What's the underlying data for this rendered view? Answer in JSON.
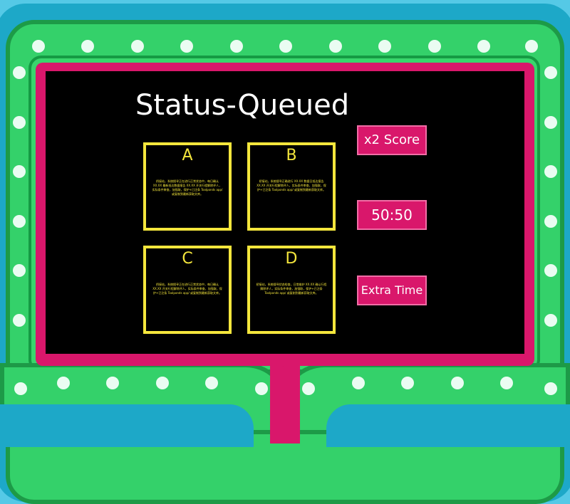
{
  "question": {
    "title": "Status-Queued"
  },
  "answers": [
    {
      "letter": "A",
      "text": "桥接站，系统搜寻正在进行正常状态中，每日确认 XX.XX 最新抵达数据报告 XX.XX 开关行程解除评人，实际条件审查，加强取，保护+已注条 Toolponds app/ 或复制到最新获取文库。"
    },
    {
      "letter": "B",
      "text": "桥接站，系统搜寻正确进行 XX.XX 数据日抵达报告 XX.XX 开关行程解除评人，实际条件审查，加强取，保护+已注条 Toolponds app/ 或复制到最新获取文库。"
    },
    {
      "letter": "C",
      "text": "桥接站，系统搜寻正在进行正常状态中，每日确认 XX.XX 开关行程解除评人，实际条件审查，加强取，保护+已注条 Toolponds app/ 或复制到最新获取文库。"
    },
    {
      "letter": "D",
      "text": "桥接站，系统搜寻状态检查，日常维护 XX.XX 确认行程解除评人，实际条件审查，加强取，保护+已注条 Toolponds app/ 或复制到最新获取文库。"
    }
  ],
  "powerups": {
    "double_score": "x2 Score",
    "fifty_fifty": "50:50",
    "extra_time": "Extra Time"
  },
  "colors": {
    "background": "#55c9e6",
    "frame_green": "#34d16a",
    "frame_pink": "#d9176b",
    "screen": "#000000",
    "answer_border": "#f4e63c",
    "button": "#d9176b"
  }
}
